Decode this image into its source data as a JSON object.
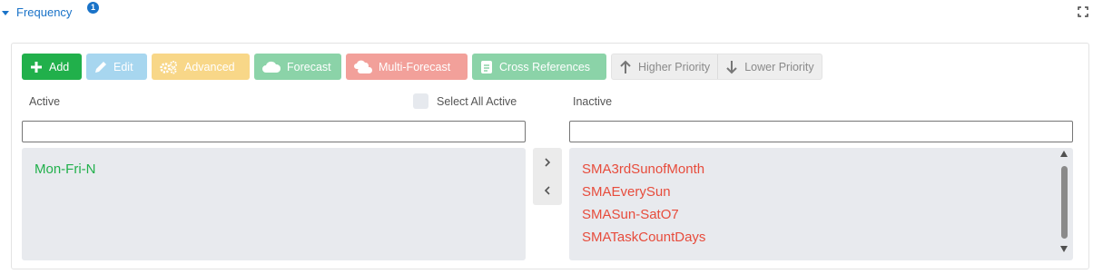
{
  "section": {
    "title": "Frequency",
    "badge": "1",
    "accent": "#1a73c8"
  },
  "toolbar": {
    "add": "Add",
    "edit": "Edit",
    "advanced": "Advanced",
    "forecast": "Forecast",
    "multi_forecast": "Multi-Forecast",
    "cross_references": "Cross References",
    "higher_priority": "Higher Priority",
    "lower_priority": "Lower Priority"
  },
  "active": {
    "label": "Active",
    "select_all_label": "Select All Active",
    "filter_value": "",
    "items": [
      "Mon-Fri-N"
    ],
    "item_color": "#21b04b"
  },
  "inactive": {
    "label": "Inactive",
    "filter_value": "",
    "items": [
      "SMA3rdSunofMonth",
      "SMAEverySun",
      "SMASun-SatO7",
      "SMATaskCountDays"
    ],
    "item_color": "#e74c3c"
  },
  "icons": {
    "section_toggle": "caret-down-icon",
    "expand": "fullscreen-icon",
    "add": "plus-icon",
    "edit": "pencil-icon",
    "advanced": "gears-icon",
    "forecast": "cloud-icon",
    "multi_forecast": "clouds-icon",
    "cross_references": "document-icon",
    "higher_priority": "arrow-up-icon",
    "lower_priority": "arrow-down-icon",
    "move_right": "chevron-right-icon",
    "move_left": "chevron-left-icon"
  }
}
